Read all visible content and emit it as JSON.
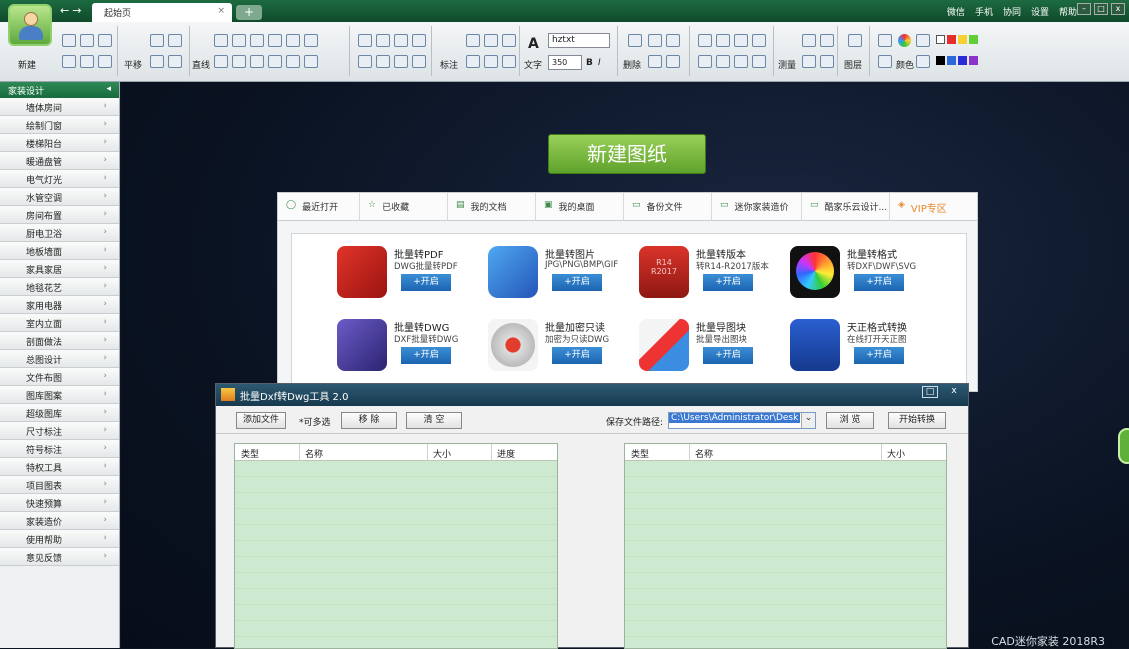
{
  "titlebar": {
    "tab_label": "起始页",
    "tab_close": "×",
    "add_tab": "+",
    "nav_back": "←",
    "nav_forward": "→",
    "right_menu": [
      "微信",
      "手机",
      "协同",
      "设置",
      "帮助"
    ],
    "win_min": "–",
    "win_max": "□",
    "win_close": "x"
  },
  "ribbon": {
    "new_label": "新建",
    "pan_label": "平移",
    "line_label": "直线",
    "mark_label": "标注",
    "text_label": "文字",
    "font_name": "hztxt",
    "font_size": "350",
    "delete_label": "删除",
    "measure_label": "测量",
    "layer_label": "图层",
    "color_label": "颜色"
  },
  "sidebar": {
    "header": "家装设计",
    "items": [
      "墙体房间",
      "绘制门窗",
      "楼梯阳台",
      "暖通盘管",
      "电气灯光",
      "水管空调",
      "房间布置",
      "厨电卫浴",
      "地板墙面",
      "家具家居",
      "地毯花艺",
      "家用电器",
      "室内立面",
      "剖面做法",
      "总图设计",
      "文件布图",
      "图库图案",
      "超级图库",
      "尺寸标注",
      "符号标注",
      "特权工具",
      "项目图表",
      "快速预算",
      "家装造价",
      "使用帮助",
      "意见反馈"
    ]
  },
  "canvas": {
    "new_drawing": "新建图纸",
    "brand": "CAD迷你家装 2018R3"
  },
  "panel": {
    "tabs": [
      "最近打开",
      "已收藏",
      "我的文档",
      "我的桌面",
      "备份文件",
      "迷你家装造价",
      "酷家乐云设计...",
      "VIP专区"
    ],
    "features": [
      {
        "title": "批量转PDF",
        "sub": "DWG批量转PDF",
        "btn": "+开启"
      },
      {
        "title": "批量转图片",
        "sub": "JPG\\PNG\\BMP\\GIF",
        "btn": "+开启"
      },
      {
        "title": "批量转版本",
        "sub": "转R14-R2017版本",
        "btn": "+开启"
      },
      {
        "title": "批量转格式",
        "sub": "转DXF\\DWF\\SVG",
        "btn": "+开启"
      },
      {
        "title": "批量转DWG",
        "sub": "DXF批量转DWG",
        "btn": "+开启"
      },
      {
        "title": "批量加密只读",
        "sub": "加密为只读DWG",
        "btn": "+开启"
      },
      {
        "title": "批量导图块",
        "sub": "批量导出图块",
        "btn": "+开启"
      },
      {
        "title": "天正格式转换",
        "sub": "在线打开天正图",
        "btn": "+开启"
      }
    ],
    "icon_text": "R14\nR2017"
  },
  "dialog": {
    "title": "批量Dxf转Dwg工具 2.0",
    "add_file": "添加文件",
    "multi": "*可多选",
    "remove": "移  除",
    "clear": "清  空",
    "save_path_label": "保存文件路径:",
    "save_path": "C:\\Users\\Administrator\\Desk",
    "browse": "浏  览",
    "start": "开始转换",
    "left_cols": [
      "类型",
      "名称",
      "大小",
      "进度"
    ],
    "right_cols": [
      "类型",
      "名称",
      "大小"
    ]
  }
}
